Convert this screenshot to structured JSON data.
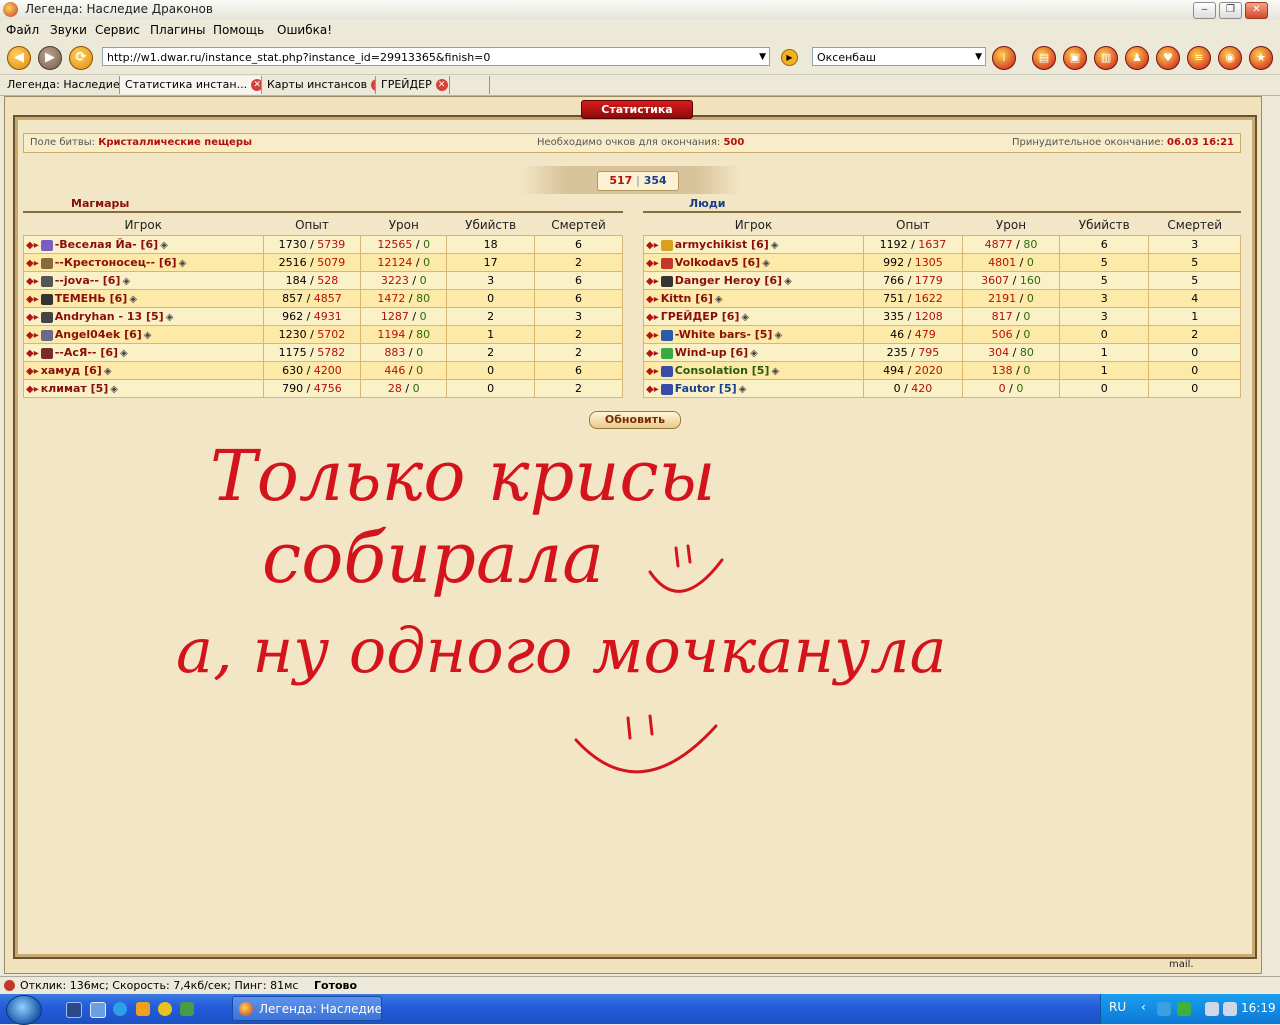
{
  "window": {
    "title": "Легенда: Наследие Драконов"
  },
  "menu": [
    "Файл",
    "Звуки",
    "Сервис",
    "Плагины",
    "Помощь",
    "Ошибка!"
  ],
  "nav": {
    "url": "http://w1.dwar.ru/instance_stat.php?instance_id=29913365&finish=0",
    "search_value": "Оксенбаш"
  },
  "tabs": [
    {
      "label": "Легенда: Наследие..."
    },
    {
      "label": "Статистика инстан..."
    },
    {
      "label": "Карты инстансов"
    },
    {
      "label": "ГРЕЙДЕР"
    }
  ],
  "page": {
    "header": "Статистика",
    "battlefield_label": "Поле битвы:",
    "battlefield_value": "Кристаллические пещеры",
    "needed_label": "Необходимо очков для окончания:",
    "needed_value": "500",
    "forced_label": "Принудительное окончание:",
    "forced_value": "06.03 16:21",
    "score_left": "517",
    "score_sep": "|",
    "score_right": "354",
    "refresh_label": "Обновить"
  },
  "columns": [
    "Игрок",
    "Опыт",
    "Урон",
    "Убийств",
    "Смертей"
  ],
  "teams": {
    "left": {
      "name": "Магмары",
      "color": "#8a0f0a",
      "rows": [
        {
          "name": "-Веселая Йа- [6]",
          "xp_a": "1730",
          "xp_b": "5739",
          "dmg_a": "12565",
          "dmg_b": "0",
          "kills": "18",
          "deaths": "6",
          "icon": "#7a5dc4"
        },
        {
          "name": "--Крестоносец-- [6]",
          "xp_a": "2516",
          "xp_b": "5079",
          "dmg_a": "12124",
          "dmg_b": "0",
          "kills": "17",
          "deaths": "2",
          "icon": "#8a6a3a"
        },
        {
          "name": "--jova-- [6]",
          "xp_a": "184",
          "xp_b": "528",
          "dmg_a": "3223",
          "dmg_b": "0",
          "kills": "3",
          "deaths": "6",
          "icon": "#555555"
        },
        {
          "name": "ТЕМЕНЬ [6]",
          "xp_a": "857",
          "xp_b": "4857",
          "dmg_a": "1472",
          "dmg_b": "80",
          "kills": "0",
          "deaths": "6",
          "icon": "#333333"
        },
        {
          "name": "Andryhan - 13 [5]",
          "xp_a": "962",
          "xp_b": "4931",
          "dmg_a": "1287",
          "dmg_b": "0",
          "kills": "2",
          "deaths": "3",
          "icon": "#444444"
        },
        {
          "name": "Angel04ek [6]",
          "xp_a": "1230",
          "xp_b": "5702",
          "dmg_a": "1194",
          "dmg_b": "80",
          "kills": "1",
          "deaths": "2",
          "icon": "#6a6a8a"
        },
        {
          "name": "--АсЯ-- [6]",
          "xp_a": "1175",
          "xp_b": "5782",
          "dmg_a": "883",
          "dmg_b": "0",
          "kills": "2",
          "deaths": "2",
          "icon": "#7a2a2a"
        },
        {
          "name": "хамуд [6]",
          "xp_a": "630",
          "xp_b": "4200",
          "dmg_a": "446",
          "dmg_b": "0",
          "kills": "0",
          "deaths": "6",
          "icon": ""
        },
        {
          "name": "климат [5]",
          "xp_a": "790",
          "xp_b": "4756",
          "dmg_a": "28",
          "dmg_b": "0",
          "kills": "0",
          "deaths": "2",
          "icon": ""
        }
      ]
    },
    "right": {
      "name": "Люди",
      "color": "#1a3f8a",
      "rows": [
        {
          "name": "armychikist [6]",
          "xp_a": "1192",
          "xp_b": "1637",
          "dmg_a": "4877",
          "dmg_b": "80",
          "kills": "6",
          "deaths": "3",
          "icon": "#d8a020",
          "cls": ""
        },
        {
          "name": "Volkodav5 [6]",
          "xp_a": "992",
          "xp_b": "1305",
          "dmg_a": "4801",
          "dmg_b": "0",
          "kills": "5",
          "deaths": "5",
          "icon": "#c0392b",
          "cls": ""
        },
        {
          "name": "Danger Heroy [6]",
          "xp_a": "766",
          "xp_b": "1779",
          "dmg_a": "3607",
          "dmg_b": "160",
          "kills": "5",
          "deaths": "5",
          "icon": "#333333",
          "cls": ""
        },
        {
          "name": "Kittn [6]",
          "xp_a": "751",
          "xp_b": "1622",
          "dmg_a": "2191",
          "dmg_b": "0",
          "kills": "3",
          "deaths": "4",
          "icon": "",
          "cls": ""
        },
        {
          "name": "ГРЕЙДЕР [6]",
          "xp_a": "335",
          "xp_b": "1208",
          "dmg_a": "817",
          "dmg_b": "0",
          "kills": "3",
          "deaths": "1",
          "icon": "",
          "cls": ""
        },
        {
          "name": "-White bars- [5]",
          "xp_a": "46",
          "xp_b": "479",
          "dmg_a": "506",
          "dmg_b": "0",
          "kills": "0",
          "deaths": "2",
          "icon": "#2a5aa8",
          "cls": ""
        },
        {
          "name": "Wind-up [6]",
          "xp_a": "235",
          "xp_b": "795",
          "dmg_a": "304",
          "dmg_b": "80",
          "kills": "1",
          "deaths": "0",
          "icon": "#3aa845",
          "cls": ""
        },
        {
          "name": "Consolation [5]",
          "xp_a": "494",
          "xp_b": "2020",
          "dmg_a": "138",
          "dmg_b": "0",
          "kills": "1",
          "deaths": "0",
          "icon": "#3a4aa8",
          "cls": "grn"
        },
        {
          "name": "Fautor [5]",
          "xp_a": "0",
          "xp_b": "420",
          "dmg_a": "0",
          "dmg_b": "0",
          "kills": "0",
          "deaths": "0",
          "icon": "#3a4aa8",
          "cls": "blu"
        }
      ]
    }
  },
  "handwriting": {
    "line1": "Только крисы",
    "line2": "собирала",
    "line3": "а, ну одного мочканула",
    "ink": "#d4141c"
  },
  "statusbar": {
    "metrics": "Отклик: 136мс; Скорость: 7,4кб/сек; Пинг: 81мс",
    "state": "Готово"
  },
  "taskbar": {
    "button": "Легенда: Наследие ...",
    "lang": "RU",
    "clock": "16:19"
  },
  "watermark": "mail."
}
